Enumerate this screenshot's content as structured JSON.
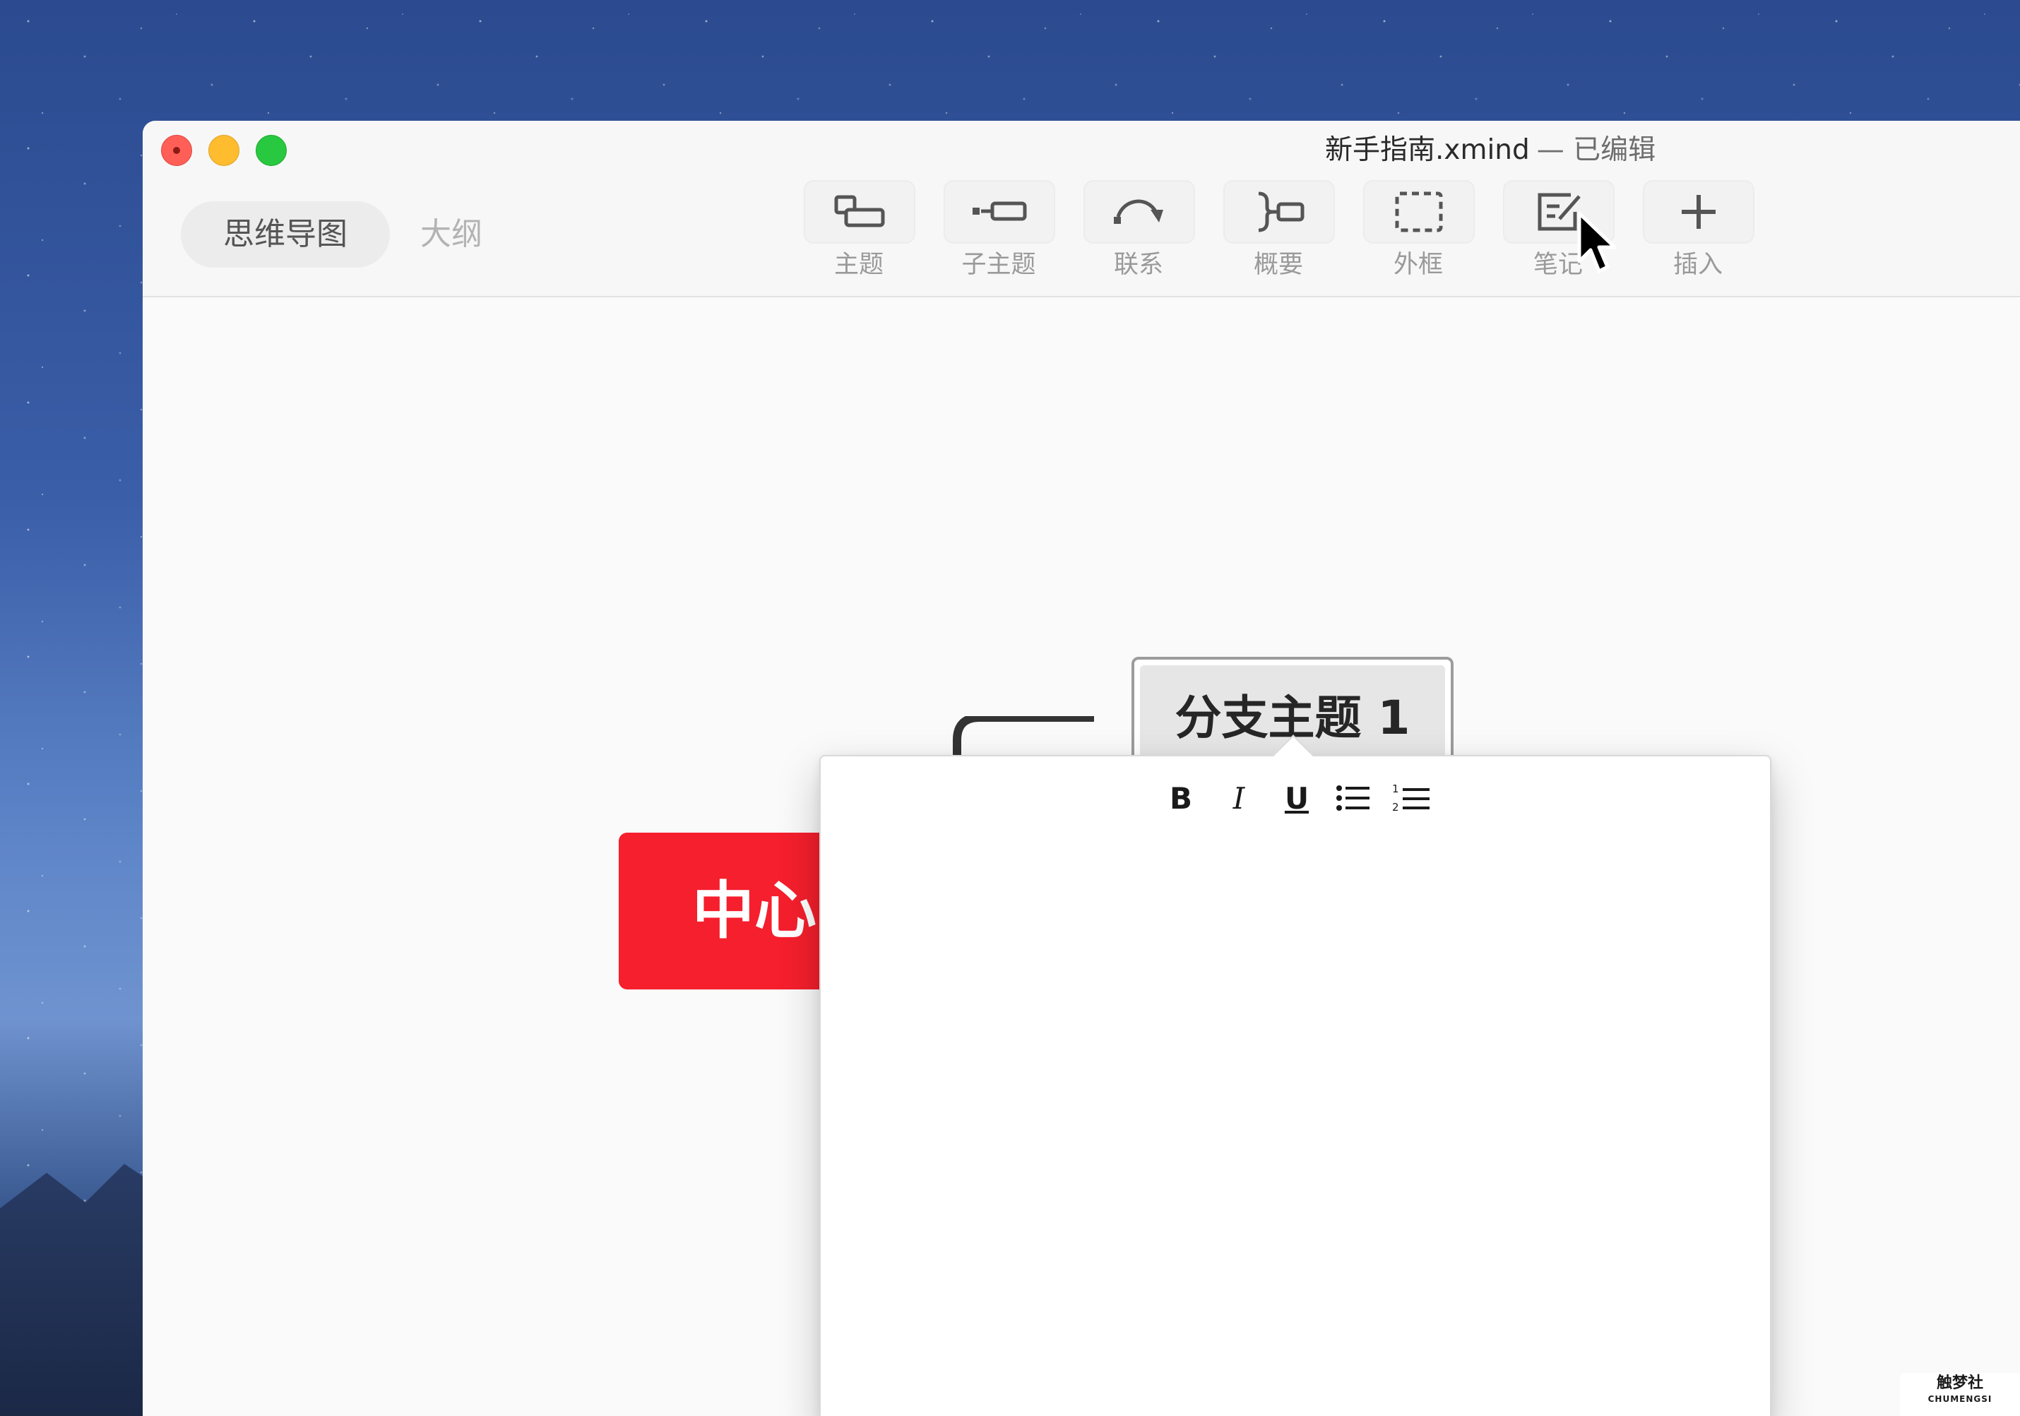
{
  "window": {
    "document_title": "新手指南.xmind",
    "edited_status": "— 已编辑"
  },
  "view_tabs": {
    "mindmap": "思维导图",
    "outline": "大纲"
  },
  "toolbar": {
    "items": [
      {
        "label": "主题",
        "icon": "topic-icon"
      },
      {
        "label": "子主题",
        "icon": "subtopic-icon"
      },
      {
        "label": "联系",
        "icon": "relationship-icon"
      },
      {
        "label": "概要",
        "icon": "summary-icon"
      },
      {
        "label": "外框",
        "icon": "boundary-icon"
      },
      {
        "label": "笔记",
        "icon": "note-icon"
      },
      {
        "label": "插入",
        "icon": "insert-icon"
      }
    ]
  },
  "mindmap": {
    "central_topic": "中心主题",
    "branch_topic": "分支主题 1"
  },
  "note_editor": {
    "format_buttons": {
      "bold": "B",
      "italic": "I",
      "underline": "U"
    },
    "content": ""
  },
  "watermark": {
    "text": "触梦社",
    "subtext": "CHUMENGSI"
  },
  "colors": {
    "central_topic": "#f51f2d",
    "branch_topic_fill": "#e6e6e6",
    "connector": "#333333"
  }
}
